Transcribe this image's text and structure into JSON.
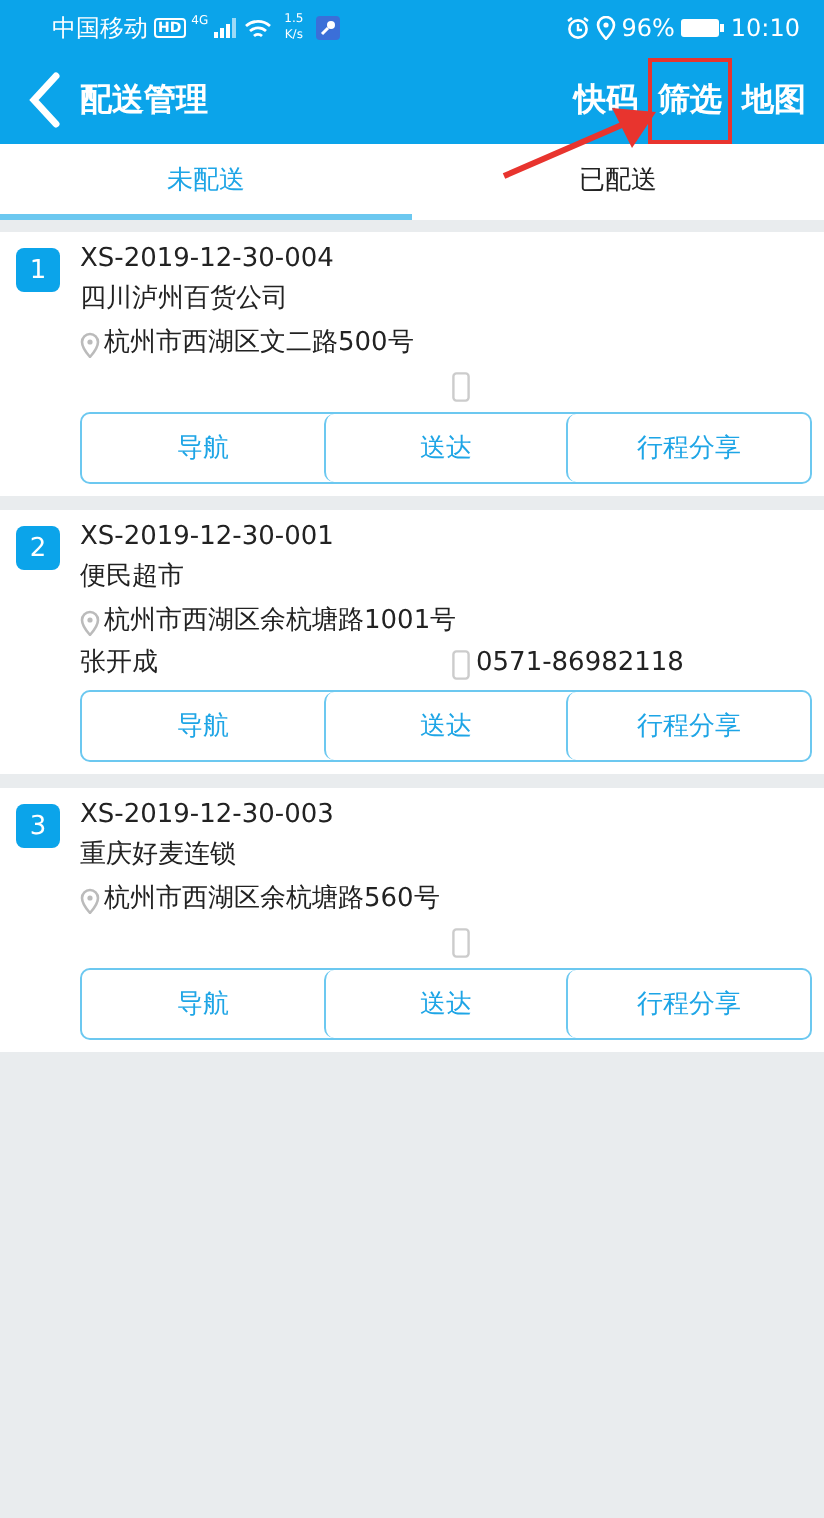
{
  "status_bar": {
    "carrier": "中国移动",
    "hd": "HD",
    "network": "4G",
    "speed_value": "1.5",
    "speed_unit": "K/s",
    "battery": "96%",
    "time": "10:10"
  },
  "header": {
    "title": "配送管理",
    "actions": [
      {
        "label": "快码",
        "highlighted": false
      },
      {
        "label": "筛选",
        "highlighted": true
      },
      {
        "label": "地图",
        "highlighted": false
      }
    ]
  },
  "tabs": [
    {
      "label": "未配送",
      "selected": true
    },
    {
      "label": "已配送",
      "selected": false
    }
  ],
  "orders": [
    {
      "index": "1",
      "number": "XS-2019-12-30-004",
      "customer": "四川泸州百货公司",
      "address": "杭州市西湖区文二路500号",
      "buttons": [
        "导航",
        "送达",
        "行程分享"
      ]
    },
    {
      "index": "2",
      "number": "XS-2019-12-30-001",
      "customer": "便民超市",
      "address": "杭州市西湖区余杭塘路1001号",
      "contact": "张开成",
      "phone": "0571-86982118",
      "buttons": [
        "导航",
        "送达",
        "行程分享"
      ]
    },
    {
      "index": "3",
      "number": "XS-2019-12-30-003",
      "customer": "重庆好麦连锁",
      "address": "杭州市西湖区余杭塘路560号",
      "buttons": [
        "导航",
        "送达",
        "行程分享"
      ]
    }
  ]
}
